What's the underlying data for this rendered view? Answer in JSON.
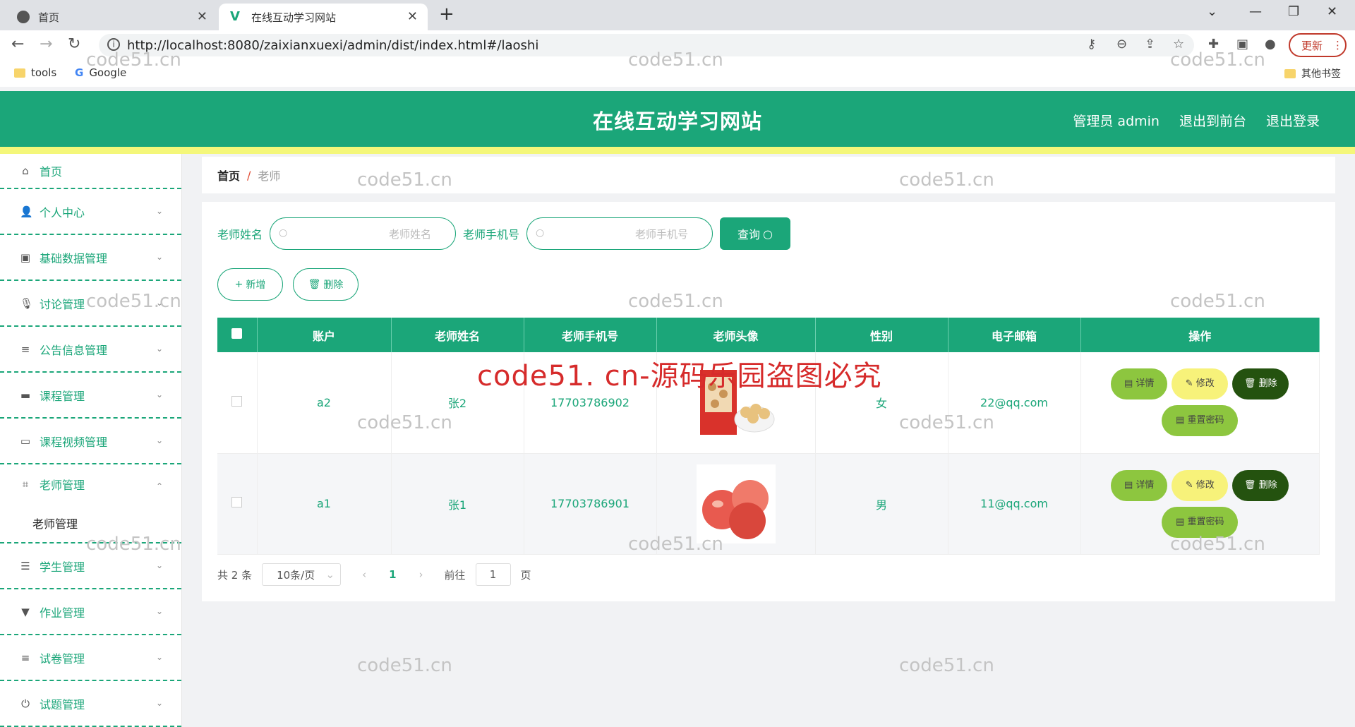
{
  "browser": {
    "tabs": [
      {
        "label": "首页"
      },
      {
        "label": "在线互动学习网站"
      }
    ],
    "url": "http://localhost:8080/zaixianxuexi/admin/dist/index.html#/laoshi",
    "update_label": "更新",
    "bookmarks": [
      {
        "label": "tools"
      },
      {
        "label": "Google"
      }
    ],
    "other_bookmarks": "其他书签"
  },
  "header": {
    "title": "在线互动学习网站",
    "admin": "管理员 admin",
    "to_front": "退出到前台",
    "logout": "退出登录"
  },
  "sidebar": {
    "items": [
      {
        "label": "首页"
      },
      {
        "label": "个人中心"
      },
      {
        "label": "基础数据管理"
      },
      {
        "label": "讨论管理"
      },
      {
        "label": "公告信息管理"
      },
      {
        "label": "课程管理"
      },
      {
        "label": "课程视频管理"
      },
      {
        "label": "老师管理"
      },
      {
        "label": "学生管理"
      },
      {
        "label": "作业管理"
      },
      {
        "label": "试卷管理"
      },
      {
        "label": "试题管理"
      }
    ],
    "sub_item": "老师管理"
  },
  "breadcrumb": {
    "home": "首页",
    "current": "老师"
  },
  "search": {
    "name_label": "老师姓名",
    "name_placeholder": "老师姓名",
    "phone_label": "老师手机号",
    "phone_placeholder": "老师手机号",
    "query_label": "查询"
  },
  "actions": {
    "add_label": "新增",
    "delete_label": "删除"
  },
  "table": {
    "columns": [
      "账户",
      "老师姓名",
      "老师手机号",
      "老师头像",
      "性别",
      "电子邮箱",
      "操作"
    ],
    "rows": [
      {
        "account": "a2",
        "name": "张2",
        "phone": "17703786902",
        "gender": "女",
        "email": "22@qq.com",
        "avatar": "snack-bag-image"
      },
      {
        "account": "a1",
        "name": "张1",
        "phone": "17703786901",
        "gender": "男",
        "email": "11@qq.com",
        "avatar": "apples-image"
      }
    ],
    "row_actions": {
      "detail": "详情",
      "edit": "修改",
      "delete": "删除",
      "reset": "重置密码"
    }
  },
  "pagination": {
    "total": "共 2 条",
    "page_size": "10条/页",
    "current": "1",
    "goto_prefix": "前往",
    "goto_value": "1",
    "goto_suffix": "页"
  },
  "watermarks": {
    "site": "code51.cn",
    "red": "code51. cn-源码乐园盗图必究"
  },
  "colors": {
    "primary": "#1ba679",
    "accent_yellow": "#f4f77a",
    "detail_btn": "#8dc63f",
    "edit_btn": "#f7f27a",
    "delete_btn": "#24520f"
  }
}
